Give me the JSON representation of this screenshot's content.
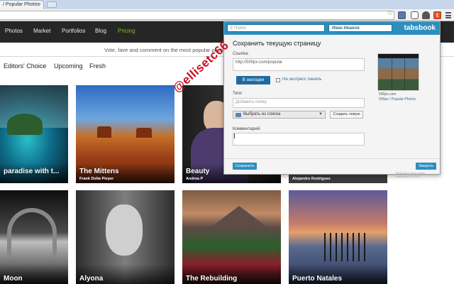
{
  "browser": {
    "tab_title": "/ Popular Photos",
    "tab_close": "×",
    "star_icon": "star-icon"
  },
  "site": {
    "nav": [
      "Photos",
      "Market",
      "Portfolios",
      "Blog",
      "Pricing"
    ],
    "active_nav": "Pricing",
    "tagline": "Vote, fave and comment on the most popular photos.",
    "filters": [
      "Editors' Choice",
      "Upcoming",
      "Fresh"
    ],
    "accent_color": "#7fbd2a"
  },
  "photos": [
    {
      "title": "paradise with t...",
      "author": ""
    },
    {
      "title": "The Mittens",
      "author": "Frank Delta Pieper"
    },
    {
      "title": "Beauty",
      "author": "Andrea P"
    },
    {
      "title": "",
      "author": "Alejandro Rodriguez"
    },
    {
      "title": "Moon",
      "author": ""
    },
    {
      "title": "Alyona",
      "author": ""
    },
    {
      "title": "The Rebuilding",
      "author": ""
    },
    {
      "title": "Puerto Natales",
      "author": ""
    }
  ],
  "popup": {
    "search_placeholder": "Поиск",
    "user_name": "Иван Иванов",
    "logo": "tabsbook",
    "heading": "Сохранить текущую страницу",
    "link_label": "Ссылка:",
    "link_value": "http://500px.com/popular",
    "tab_bookmarks": "В закладки",
    "tab_express": "На экспресс панель",
    "tags_label": "Теги:",
    "tags_placeholder": "Добавить папку",
    "folder_select": "Выбрать из списка",
    "new_folder_button": "Создать новую",
    "comment_label": "Комментарий:",
    "preview_url": "500px.com",
    "preview_title": "500px / Popular Photos",
    "save_button": "Сохранить",
    "close_button": "Закрыть",
    "copyright": "Tabsbook.ru Все права защищены © 2013",
    "brand_color": "#2b8fc0"
  },
  "watermark_text": "@ellisetc66"
}
